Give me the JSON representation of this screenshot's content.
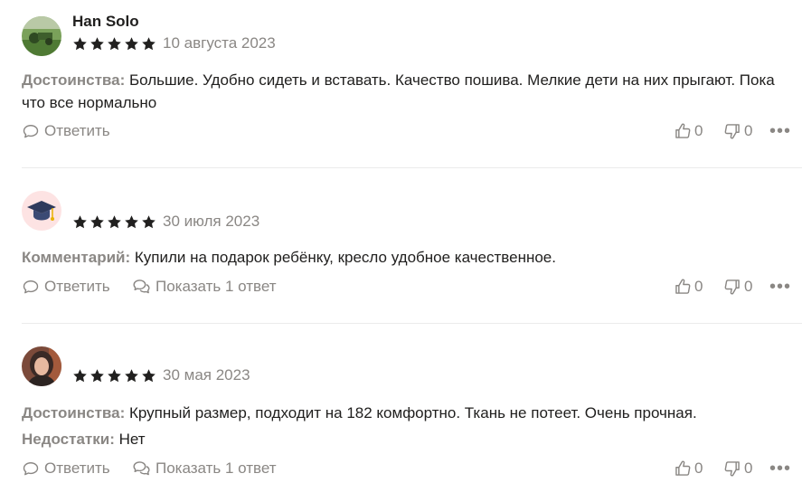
{
  "colors": {
    "text": "#21201f",
    "muted": "#8a8784",
    "divider": "#ebebeb",
    "star": "#21201f"
  },
  "reviews": [
    {
      "author": "Han Solo",
      "rating": 5,
      "date": "10 августа 2023",
      "avatar": "avatar-photo-green-landscape",
      "sections": [
        {
          "label": "Достоинства:",
          "text": "Большие. Удобно сидеть и вставать. Качество пошива. Мелкие дети на них прыгают. Пока",
          "text2": "что все нормально"
        }
      ],
      "reply_label": "Ответить",
      "likes": "0",
      "dislikes": "0"
    },
    {
      "author": "",
      "rating": 5,
      "date": "30 июля 2023",
      "avatar": "graduation-cap-icon",
      "sections": [
        {
          "label": "Комментарий:",
          "text": "Купили на подарок ребёнку, кресло удобное качественное."
        }
      ],
      "reply_label": "Ответить",
      "show_replies_label": "Показать 1 ответ",
      "likes": "0",
      "dislikes": "0"
    },
    {
      "author": "",
      "rating": 5,
      "date": "30 мая 2023",
      "avatar": "avatar-photo-woman",
      "sections": [
        {
          "label": "Достоинства:",
          "text": "Крупный размер, подходит на 182 комфортно. Ткань не потеет. Очень прочная."
        },
        {
          "label": "Недостатки:",
          "text": "Нет"
        }
      ],
      "reply_label": "Ответить",
      "show_replies_label": "Показать 1 ответ",
      "likes": "0",
      "dislikes": "0"
    }
  ],
  "more_icon": "more-dots-icon"
}
